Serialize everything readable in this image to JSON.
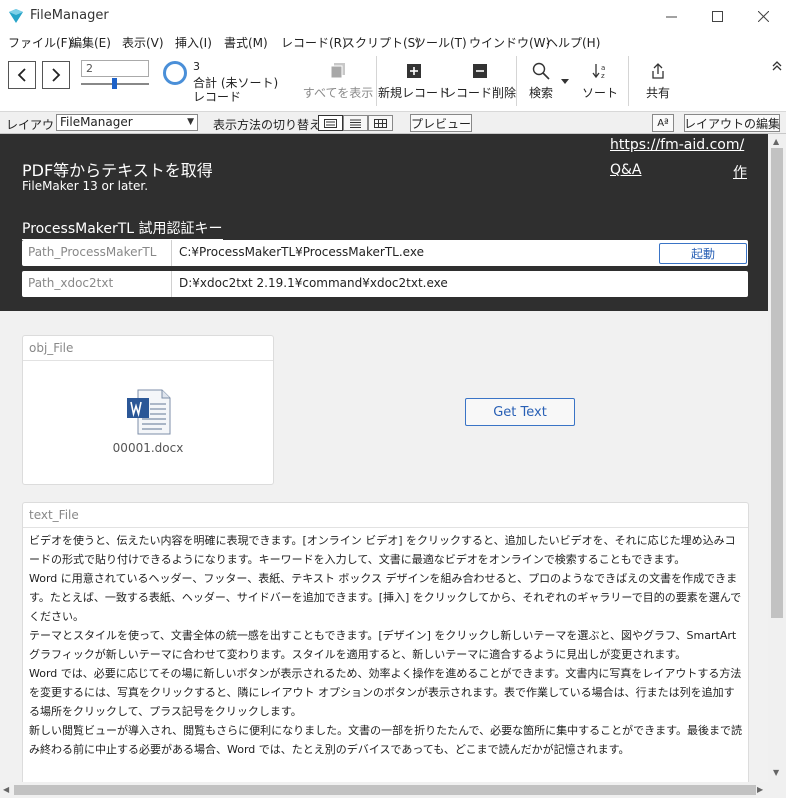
{
  "window": {
    "title": "FileManager"
  },
  "menu": [
    "ファイル(F)",
    "編集(E)",
    "表示(V)",
    "挿入(I)",
    "書式(M)",
    "レコード(R)",
    "スクリプト(S)",
    "ツール(T)",
    "ウインドウ(W)",
    "ヘルプ(H)"
  ],
  "toolbar": {
    "record_number": "2",
    "record_slider_fraction": 0.5,
    "found_count": "3",
    "sort_status": "合計 (未ソート)",
    "record_word": "レコード",
    "show_all": "すべてを表示",
    "new_record": "新規レコード",
    "delete_record": "レコード削除",
    "search": "検索",
    "sort": "ソート",
    "share": "共有"
  },
  "layout_bar": {
    "layout_label": "レイアウト:",
    "layout_value": "FileManager",
    "view_as_label": "表示方法の切り替え:",
    "preview": "プレビュー",
    "text_format": "Aª",
    "edit_layout": "レイアウトの編集"
  },
  "header": {
    "title": "PDF等からテキストを取得",
    "subtitle": "FileMaker 13 or later.",
    "site_link": "https://fm-aid.com/",
    "qa_link": "Q&A",
    "author_link": "作",
    "license_link": "ProcessMakerTL 試用認証キー"
  },
  "paths": [
    {
      "label": "Path_ProcessMakerTL",
      "value": "C:¥ProcessMakerTL¥ProcessMakerTL.exe",
      "button": "起動"
    },
    {
      "label": "Path_xdoc2txt",
      "value": "D:¥xdoc2txt 2.19.1¥command¥xdoc2txt.exe"
    }
  ],
  "obj_file": {
    "label": "obj_File",
    "file_name": "00001.docx"
  },
  "get_text": "Get Text",
  "text_file": {
    "label": "text_File",
    "lines": [
      "ビデオを使うと、伝えたい内容を明確に表現できます。[オンライン ビデオ] をクリックすると、追加したいビデオを、それに応じた埋め込みコードの形式で貼り付けできるようになります。キーワードを入力して、文書に最適なビデオをオンラインで検索することもできます。",
      "Word に用意されているヘッダー、フッター、表紙、テキスト ボックス デザインを組み合わせると、プロのようなできばえの文書を作成できます。たとえば、一致する表紙、ヘッダー、サイドバーを追加できます。[挿入] をクリックしてから、それぞれのギャラリーで目的の要素を選んでください。",
      "テーマとスタイルを使って、文書全体の統一感を出すこともできます。[デザイン] をクリックし新しいテーマを選ぶと、図やグラフ、SmartArt グラフィックが新しいテーマに合わせて変わります。スタイルを適用すると、新しいテーマに適合するように見出しが変更されます。",
      "Word では、必要に応じてその場に新しいボタンが表示されるため、効率よく操作を進めることができます。文書内に写真をレイアウトする方法を変更するには、写真をクリックすると、隣にレイアウト オプションのボタンが表示されます。表で作業している場合は、行または列を追加する場所をクリックして、プラス記号をクリックします。",
      "新しい閲覧ビューが導入され、閲覧もさらに便利になりました。文書の一部を折りたたんで、必要な箇所に集中することができます。最後まで読み終わる前に中止する必要がある場合、Word では、たとえ別のデバイスであっても、どこまで読んだかが記憶されます。"
    ]
  },
  "colors": {
    "header_band": "#2f2f2f",
    "accent_blue": "#2960b5",
    "background": "#f1f1f1"
  }
}
